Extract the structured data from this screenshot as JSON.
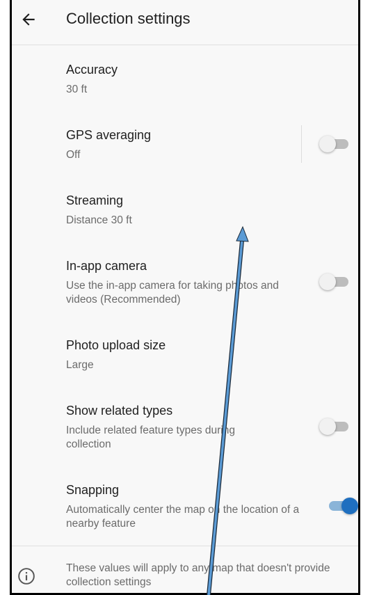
{
  "header": {
    "title": "Collection settings",
    "back_icon": "arrow-left-icon"
  },
  "settings": [
    {
      "label": "Accuracy",
      "value": "30 ft"
    },
    {
      "label": "GPS averaging",
      "value": "Off",
      "toggle": false
    },
    {
      "label": "Streaming",
      "value": "Distance 30 ft"
    },
    {
      "label": "In-app camera",
      "value": "Use the in-app camera for taking photos and videos (Recommended)",
      "toggle": false
    },
    {
      "label": "Photo upload size",
      "value": "Large"
    },
    {
      "label": "Show related types",
      "value": "Include related feature types during collection",
      "toggle": false
    },
    {
      "label": "Snapping",
      "value": "Automatically center the map on the location of a nearby feature",
      "toggle": true
    }
  ],
  "footer": {
    "icon": "info-icon",
    "note": "These values will apply to any map that doesn't provide collection settings"
  },
  "colors": {
    "accent": "#1f6fbf",
    "annotation_arrow": "#5b9bd5"
  }
}
